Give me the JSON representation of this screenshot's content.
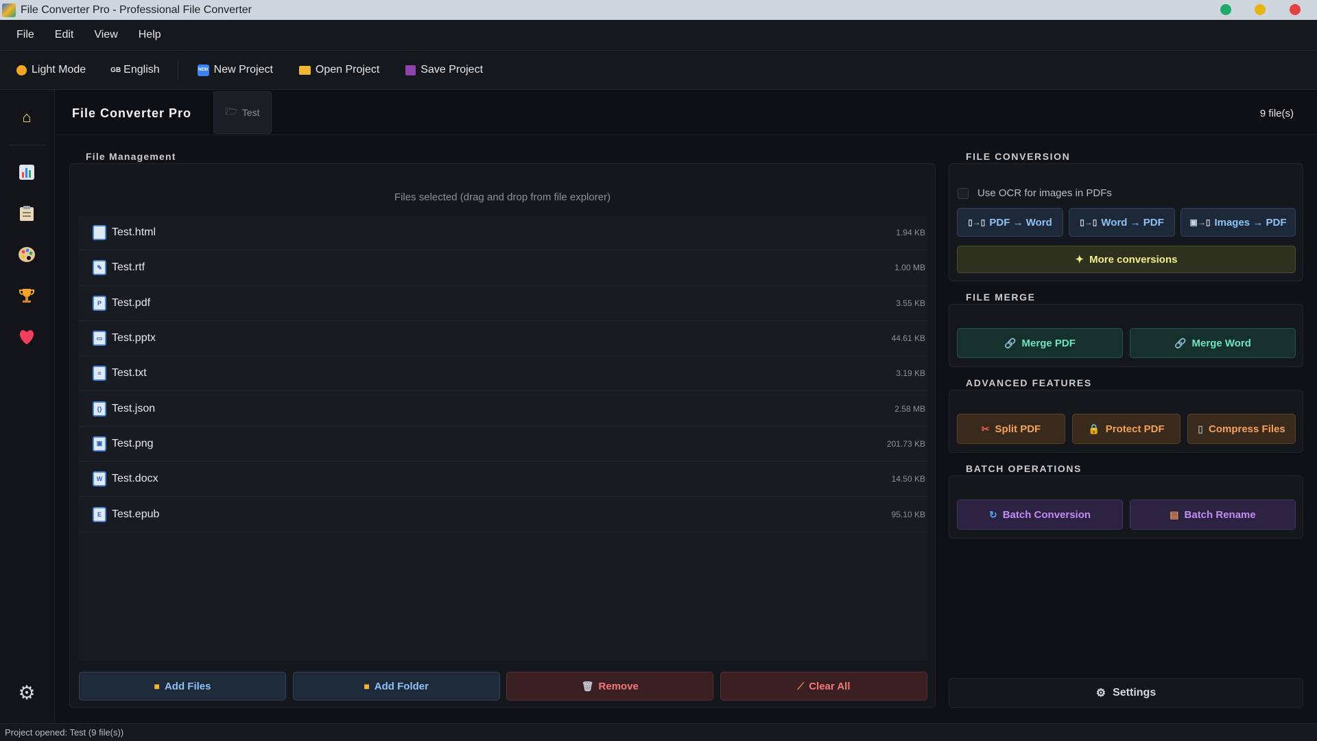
{
  "window": {
    "title": "File Converter Pro - Professional File Converter",
    "controls": {
      "minimize_color": "#1fa86b",
      "maximize_color": "#e7b416",
      "close_color": "#e34040"
    }
  },
  "menu": [
    "File",
    "Edit",
    "View",
    "Help"
  ],
  "toolbar": {
    "theme_label": "Light Mode",
    "language_label": "English",
    "language_flag": "GB",
    "new_project": "New Project",
    "open_project": "Open Project",
    "save_project": "Save Project"
  },
  "sidebar": {
    "icons": [
      "home-icon",
      "chart-icon",
      "clipboard-icon",
      "palette-icon",
      "trophy-icon",
      "heart-icon",
      "gear-icon"
    ]
  },
  "header": {
    "app_name": "File Converter Pro",
    "project_tab": "Test",
    "file_count": "9 file(s)"
  },
  "file_management": {
    "label": "File Management",
    "drop_hint": "Files selected (drag and drop from file explorer)",
    "files": [
      {
        "name": "Test.html",
        "size": "1.94 KB"
      },
      {
        "name": "Test.rtf",
        "size": "1.00 MB"
      },
      {
        "name": "Test.pdf",
        "size": "3.55 KB"
      },
      {
        "name": "Test.pptx",
        "size": "44.61 KB"
      },
      {
        "name": "Test.txt",
        "size": "3.19 KB"
      },
      {
        "name": "Test.json",
        "size": "2.58 MB"
      },
      {
        "name": "Test.png",
        "size": "201.73 KB"
      },
      {
        "name": "Test.docx",
        "size": "14.50 KB"
      },
      {
        "name": "Test.epub",
        "size": "95.10 KB"
      }
    ],
    "buttons": {
      "add_files": "Add Files",
      "add_folder": "Add Folder",
      "remove": "Remove",
      "clear_all": "Clear All"
    }
  },
  "file_conversion": {
    "label": "FILE CONVERSION",
    "ocr_label": "Use OCR for images in PDFs",
    "pdf_to_word": "PDF → Word",
    "word_to_pdf": "Word → PDF",
    "images_to_pdf": "Images → PDF",
    "more": "More conversions"
  },
  "file_merge": {
    "label": "FILE MERGE",
    "merge_pdf": "Merge PDF",
    "merge_word": "Merge Word"
  },
  "advanced": {
    "label": "ADVANCED FEATURES",
    "split_pdf": "Split PDF",
    "protect_pdf": "Protect PDF",
    "compress": "Compress Files"
  },
  "batch": {
    "label": "BATCH OPERATIONS",
    "batch_conversion": "Batch Conversion",
    "batch_rename": "Batch Rename"
  },
  "settings_label": "Settings",
  "status": "Project opened: Test  (9 file(s))"
}
